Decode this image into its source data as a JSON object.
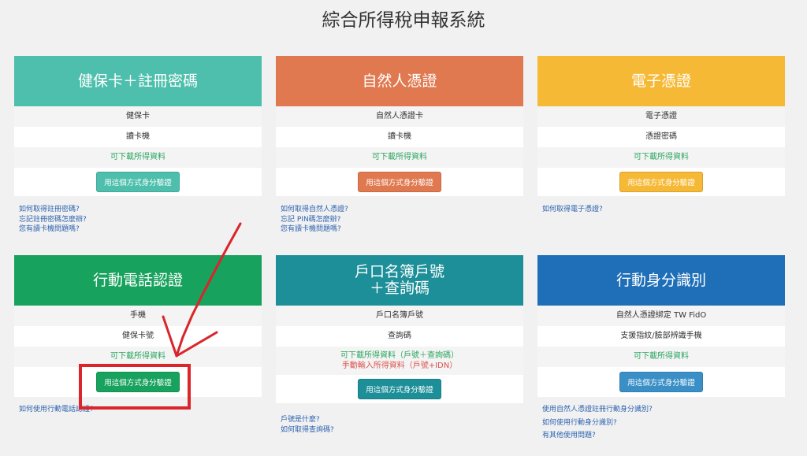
{
  "page": {
    "title": "綜合所得稅申報系統"
  },
  "colors": {
    "teal": "#4dbfac",
    "orange": "#e07950",
    "yellow": "#f6b936",
    "green": "#17a25d",
    "darkteal": "#1d8f98",
    "blue": "#1e6fb7",
    "link": "#2f64b0",
    "annotation": "#d9252b"
  },
  "cards": [
    {
      "title": [
        "健保卡＋註冊密碼"
      ],
      "rows": [
        "健保卡",
        "讀卡機"
      ],
      "notes": [
        "可下載所得資料"
      ],
      "button": "用這個方式身分驗證",
      "links": [
        "如何取得註冊密碼?",
        "忘記註冊密碼怎麼辦?",
        "您有讀卡機問題嗎?"
      ]
    },
    {
      "title": [
        "自然人憑證"
      ],
      "rows": [
        "自然人憑證卡",
        "讀卡機"
      ],
      "notes": [
        "可下載所得資料"
      ],
      "button": "用這個方式身分驗證",
      "links": [
        "如何取得自然人憑證?",
        "忘記 PIN碼怎麼辦?",
        "您有讀卡機問題嗎?"
      ]
    },
    {
      "title": [
        "電子憑證"
      ],
      "rows": [
        "電子憑證",
        "憑證密碼"
      ],
      "notes": [
        "可下載所得資料"
      ],
      "button": "用這個方式身分驗證",
      "links": [
        "如何取得電子憑證?"
      ]
    },
    {
      "title": [
        "行動電話認證"
      ],
      "rows": [
        "手機",
        "健保卡號"
      ],
      "notes": [
        "可下載所得資料"
      ],
      "button": "用這個方式身分驗證",
      "links": [
        "如何使用行動電話認證?"
      ]
    },
    {
      "title": [
        "戶口名簿戶號",
        "＋查詢碼"
      ],
      "rows": [
        "戶口名簿戶號",
        "查詢碼"
      ],
      "notes": [
        "可下載所得資料（戶號＋查詢碼）",
        "手動輸入所得資料（戶號+IDN）"
      ],
      "button": "用這個方式身分驗證",
      "links": [
        "戶號是什麼?",
        "如何取得查詢碼?"
      ]
    },
    {
      "title": [
        "行動身分識別"
      ],
      "rows": [
        "自然人憑證綁定 TW FidO",
        "支援指紋/臉部辨識手機"
      ],
      "notes": [
        "可下載所得資料"
      ],
      "button": "用這個方式身分驗證",
      "links": [
        "使用自然人憑證註冊行動身分識別?",
        "如何使用行動身分識別?",
        "有其他使用問題?"
      ]
    }
  ]
}
